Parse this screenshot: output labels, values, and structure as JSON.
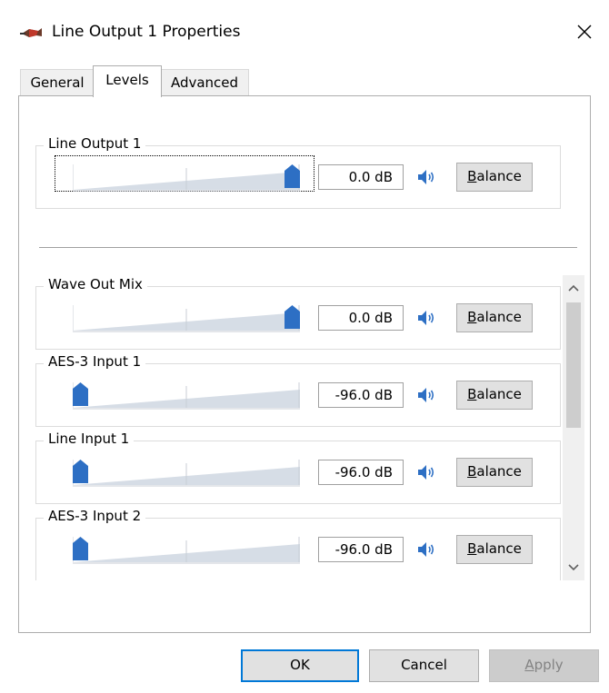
{
  "window": {
    "title": "Line Output 1 Properties",
    "close_symbol": "×",
    "icon": "speaker-cable-icon"
  },
  "tabs": [
    {
      "label": "General",
      "active": false
    },
    {
      "label": "Levels",
      "active": true
    },
    {
      "label": "Advanced",
      "active": false
    }
  ],
  "main_level": {
    "name": "Line Output 1",
    "value_db": "0.0 dB",
    "level_fraction": 1.0,
    "balance_label": "Balance",
    "focused": true
  },
  "mixer_levels": [
    {
      "name": "Wave Out Mix",
      "value_db": "0.0 dB",
      "level_fraction": 1.0,
      "balance_label": "Balance"
    },
    {
      "name": "AES-3 Input 1",
      "value_db": "-96.0 dB",
      "level_fraction": 0.0,
      "balance_label": "Balance"
    },
    {
      "name": "Line Input 1",
      "value_db": "-96.0 dB",
      "level_fraction": 0.0,
      "balance_label": "Balance"
    },
    {
      "name": "AES-3 Input 2",
      "value_db": "-96.0 dB",
      "level_fraction": 0.0,
      "balance_label": "Balance"
    }
  ],
  "scrollbar": {
    "up_symbol": "∧",
    "down_symbol": "∨"
  },
  "buttons": {
    "ok": "OK",
    "cancel": "Cancel",
    "apply": "Apply"
  },
  "colors": {
    "accent": "#2d6fc4",
    "track": "#d6dde6",
    "focus_border": "#0078d7"
  }
}
